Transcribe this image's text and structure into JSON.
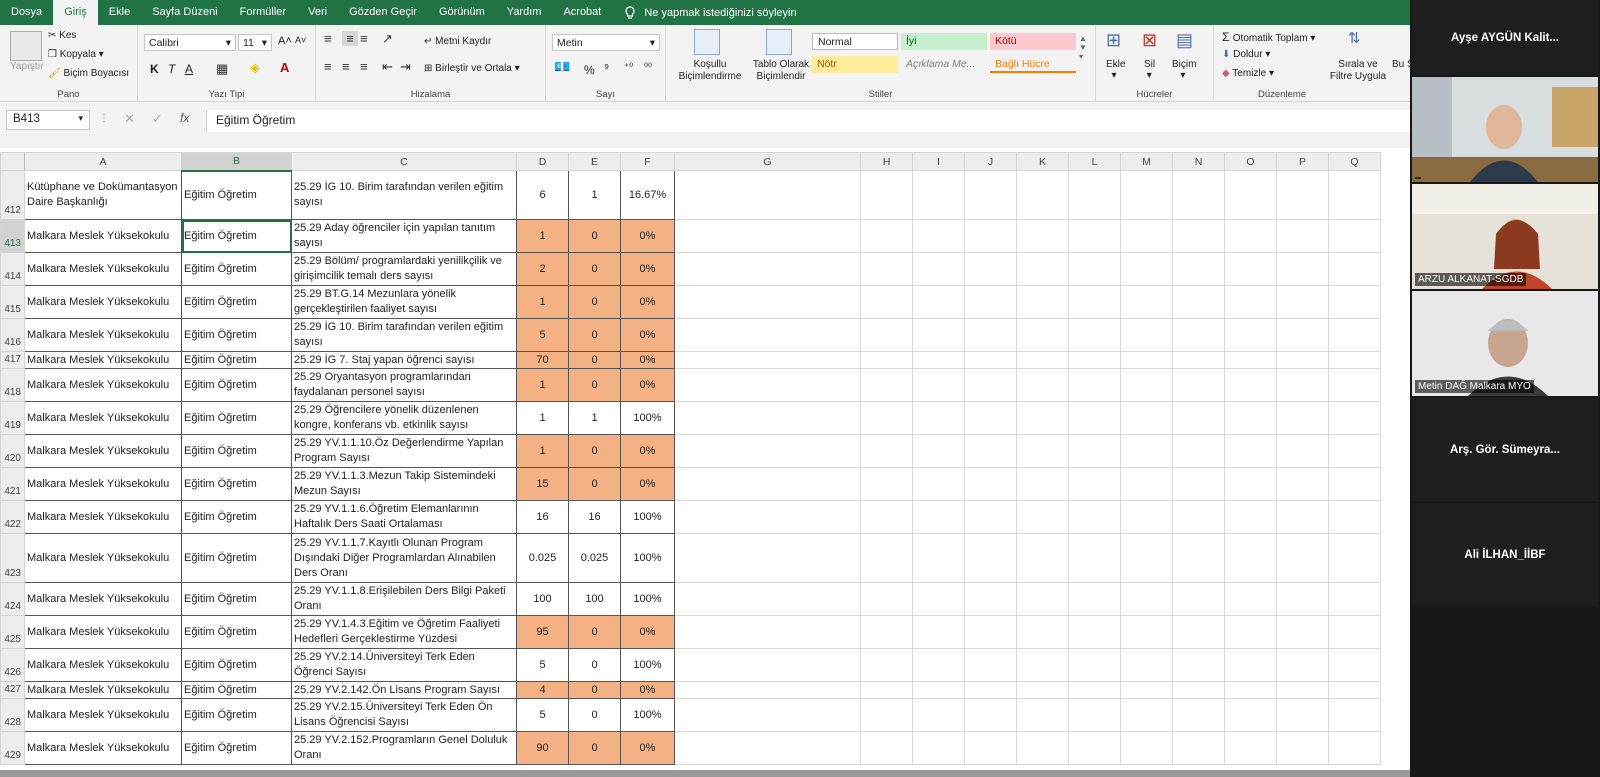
{
  "menu": {
    "tabs": [
      "Dosya",
      "Giriş",
      "Ekle",
      "Sayfa Düzeni",
      "Formüller",
      "Veri",
      "Gözden Geçir",
      "Görünüm",
      "Yardım",
      "Acrobat"
    ],
    "tell_me": "Ne yapmak istediğinizi söyleyin",
    "active_tab": "Giriş"
  },
  "ribbon": {
    "pano": {
      "label": "Pano",
      "paste": "Yapıştır",
      "cut": "Kes",
      "copy": "Kopyala",
      "painter": "Biçim Boyacısı"
    },
    "yazi": {
      "label": "Yazı Tipi",
      "font": "Calibri",
      "size": "11",
      "bold": "K",
      "italic": "T",
      "underline": "A",
      "grow": "A",
      "shrink": "A"
    },
    "hizalama": {
      "label": "Hizalama",
      "wrap": "Metni Kaydır",
      "merge": "Birleştir ve Ortala"
    },
    "sayi": {
      "label": "Sayı",
      "format": "Metin",
      "percent": "%",
      "comma": "⁹",
      "dec_up": "⁺⁰",
      "dec_down": "⁰⁰"
    },
    "stiller": {
      "label": "Stiller",
      "cond_format": "Koşullu Biçimlendirme",
      "table_format": "Tablo Olarak Biçimlendir",
      "styles": [
        "Normal",
        "İyi",
        "Kötü",
        "Nötr",
        "Açıklama Me...",
        "Bağlı Hücre"
      ],
      "style_colors": {
        "normal": "#ffffff",
        "good": "#c6efce",
        "bad": "#ffc7ce",
        "neutral": "#ffeb9c",
        "note": "#f3f3f3",
        "linked": "#f3f3f3"
      }
    },
    "hucreler": {
      "label": "Hücreler",
      "insert": "Ekle",
      "delete": "Sil",
      "format": "Biçim"
    },
    "duzenleme": {
      "label": "Düzenleme",
      "autosum": "Otomatik Toplam",
      "fill": "Doldur",
      "clear": "Temizle",
      "sort": "Sırala ve Filtre Uygula",
      "find": "Bu S"
    }
  },
  "formula_bar": {
    "name_box": "B413",
    "fx": "fx",
    "content": "Eğitim Öğretim"
  },
  "grid": {
    "columns": [
      "A",
      "B",
      "C",
      "D",
      "E",
      "F",
      "G",
      "H",
      "I",
      "J",
      "K",
      "L",
      "M",
      "N",
      "O",
      "P",
      "Q"
    ],
    "selected_cell": "B413",
    "orange_color": "#f4b183",
    "rows": [
      {
        "n": "412",
        "a": "Kütüphane ve Dokümantasyon Daire Başkanlığı",
        "b": "Eğitim Öğretim",
        "c": "25.29 İG 10. Birim tarafından verilen eğitim sayısı",
        "d": "6",
        "e": "1",
        "f": "16.67%",
        "orange": false
      },
      {
        "n": "413",
        "a": "Malkara Meslek Yüksekokulu",
        "b": "Eğitim Öğretim",
        "c": "25.29 Aday öğrenciler için yapılan tanıtım sayısı",
        "d": "1",
        "e": "0",
        "f": "0%",
        "orange": true
      },
      {
        "n": "414",
        "a": "Malkara Meslek Yüksekokulu",
        "b": "Eğitim Öğretim",
        "c": "25.29 Bölüm/ programlardaki yenilikçilik ve girişimcilik temalı ders sayısı",
        "d": "2",
        "e": "0",
        "f": "0%",
        "orange": true
      },
      {
        "n": "415",
        "a": "Malkara Meslek Yüksekokulu",
        "b": "Eğitim Öğretim",
        "c": "25.29 BT.G.14 Mezunlara yönelik gerçekleştirilen faaliyet sayısı",
        "d": "1",
        "e": "0",
        "f": "0%",
        "orange": true
      },
      {
        "n": "416",
        "a": "Malkara Meslek Yüksekokulu",
        "b": "Eğitim Öğretim",
        "c": "25.29 İG 10. Birim tarafından verilen eğitim sayısı",
        "d": "5",
        "e": "0",
        "f": "0%",
        "orange": true
      },
      {
        "n": "417",
        "a": "Malkara Meslek Yüksekokulu",
        "b": "Eğitim Öğretim",
        "c": "25.29 İG 7. Staj yapan öğrenci sayısı",
        "d": "70",
        "e": "0",
        "f": "0%",
        "orange": true
      },
      {
        "n": "418",
        "a": "Malkara Meslek Yüksekokulu",
        "b": "Eğitim Öğretim",
        "c": "25.29 Oryantasyon programlarından faydalanan personel sayısı",
        "d": "1",
        "e": "0",
        "f": "0%",
        "orange": true
      },
      {
        "n": "419",
        "a": "Malkara Meslek Yüksekokulu",
        "b": "Eğitim Öğretim",
        "c": "25.29 Öğrencilere yönelik düzenlenen kongre, konferans vb. etkinlik sayısı",
        "d": "1",
        "e": "1",
        "f": "100%",
        "orange": false
      },
      {
        "n": "420",
        "a": "Malkara Meslek Yüksekokulu",
        "b": "Eğitim Öğretim",
        "c": "25.29 YV.1.1.10.Öz Değerlendirme Yapılan Program Sayısı",
        "d": "1",
        "e": "0",
        "f": "0%",
        "orange": true
      },
      {
        "n": "421",
        "a": "Malkara Meslek Yüksekokulu",
        "b": "Eğitim Öğretim",
        "c": "25.29 YV.1.1.3.Mezun Takip Sistemindeki Mezun Sayısı",
        "d": "15",
        "e": "0",
        "f": "0%",
        "orange": true
      },
      {
        "n": "422",
        "a": "Malkara Meslek Yüksekokulu",
        "b": "Eğitim Öğretim",
        "c": "25.29 YV.1.1.6.Öğretim Elemanlarının Haftalık Ders Saati Ortalaması",
        "d": "16",
        "e": "16",
        "f": "100%",
        "orange": false
      },
      {
        "n": "423",
        "a": "Malkara Meslek Yüksekokulu",
        "b": "Eğitim Öğretim",
        "c": "25.29 YV.1.1.7.Kayıtlı Olunan Program Dışındaki Diğer Programlardan Alınabilen Ders Oranı",
        "d": "0.025",
        "e": "0.025",
        "f": "100%",
        "orange": false
      },
      {
        "n": "424",
        "a": "Malkara Meslek Yüksekokulu",
        "b": "Eğitim Öğretim",
        "c": "25.29 YV.1.1.8.Erişilebilen Ders Bilgi Paketi Oranı",
        "d": "100",
        "e": "100",
        "f": "100%",
        "orange": false
      },
      {
        "n": "425",
        "a": "Malkara Meslek Yüksekokulu",
        "b": "Eğitim Öğretim",
        "c": "25.29 YV.1.4.3.Eğitim ve Öğretim Faaliyeti Hedefleri Gerçeklestirme Yüzdesi",
        "d": "95",
        "e": "0",
        "f": "0%",
        "orange": true
      },
      {
        "n": "426",
        "a": "Malkara Meslek Yüksekokulu",
        "b": "Eğitim Öğretim",
        "c": "25.29 YV.2.14.Üniversiteyi Terk Eden Öğrenci Sayısı",
        "d": "5",
        "e": "0",
        "f": "100%",
        "orange": false
      },
      {
        "n": "427",
        "a": "Malkara Meslek Yüksekokulu",
        "b": "Eğitim Öğretim",
        "c": "25.29 YV.2.142.Ön Lisans Program Sayısı",
        "d": "4",
        "e": "0",
        "f": "0%",
        "orange": true
      },
      {
        "n": "428",
        "a": "Malkara Meslek Yüksekokulu",
        "b": "Eğitim Öğretim",
        "c": "25.29 YV.2.15.Üniversiteyi Terk Eden Ön Lisans Öğrencisi Sayısı",
        "d": "5",
        "e": "0",
        "f": "100%",
        "orange": false
      },
      {
        "n": "429",
        "a": "Malkara Meslek Yüksekokulu",
        "b": "Eğitim Öğretim",
        "c": "25.29 YV.2.152.Programların Genel Doluluk Oranı",
        "d": "90",
        "e": "0",
        "f": "0%",
        "orange": true
      }
    ]
  },
  "participants": [
    {
      "name": "Ayşe AYGÜN Kalit...",
      "video": false
    },
    {
      "name": "",
      "video": true
    },
    {
      "name": "ARZU ALKANAT-SGDB",
      "video": true
    },
    {
      "name": "Metin DAĞ Malkara MYO",
      "video": true
    },
    {
      "name": "Arş. Gör. Sümeyra...",
      "video": false
    },
    {
      "name": "Ali İLHAN_İİBF",
      "video": false
    }
  ]
}
